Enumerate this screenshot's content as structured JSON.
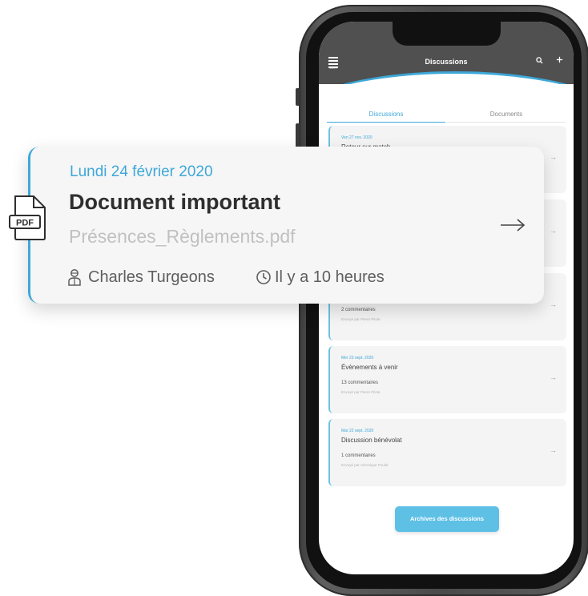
{
  "app": {
    "menu_label": "MENU",
    "header_title": "Discussions",
    "icons": {
      "menu": "hamburger-icon",
      "search": "search-icon",
      "add": "plus-icon"
    },
    "accent_color": "#3ea8d8"
  },
  "tabs": [
    {
      "label": "Discussions",
      "active": true
    },
    {
      "label": "Documents",
      "active": false
    }
  ],
  "discussions": [
    {
      "date": "Ven 27 nov. 2020",
      "title": "Retour sur match",
      "comments": "",
      "sender": ""
    },
    {
      "date": "",
      "title": "",
      "comments": "",
      "sender": ""
    },
    {
      "date": "",
      "title": "",
      "comments": "2 commentaires",
      "sender": "Envoyé par Pierre Pilote"
    },
    {
      "date": "Mer 23 sept. 2020",
      "title": "Évènements à venir",
      "comments": "13 commentaires",
      "sender": "Envoyé par Pierre Pilote"
    },
    {
      "date": "Mar 22 sept. 2020",
      "title": "Discussion bénévolat",
      "comments": "1 commentaires",
      "sender": "Envoyé par Véronique Poulet"
    }
  ],
  "archives_button": "Archives des discussions",
  "document_card": {
    "date": "Lundi 24 février 2020",
    "title": "Document important",
    "file_name": "Présences_Règlements.pdf",
    "author": "Charles Turgeons",
    "time_ago": "Il y a 10 heures",
    "file_badge": "PDF"
  }
}
